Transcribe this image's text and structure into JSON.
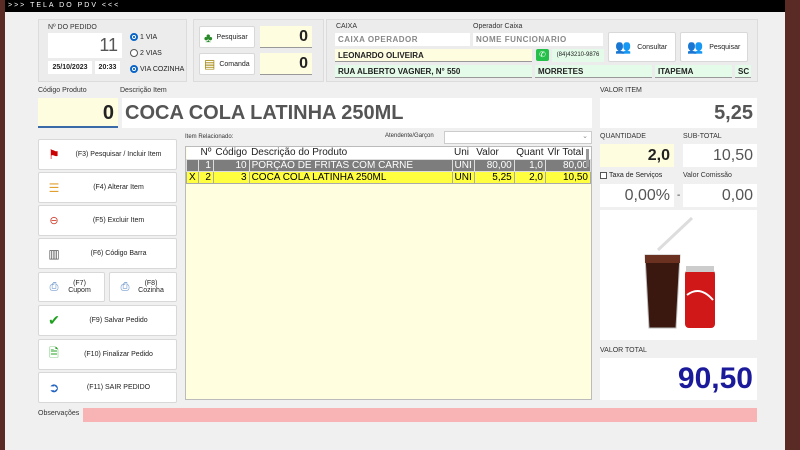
{
  "window": {
    "title": ">>> TELA DO PDV <<<"
  },
  "pedido": {
    "label": "Nº DO PEDIDO",
    "number": "11",
    "date": "25/10/2023",
    "time": "20:33",
    "options": [
      {
        "label": "1 VIA",
        "checked": true
      },
      {
        "label": "2 VIAS",
        "checked": false
      },
      {
        "label": "VIA COZINHA",
        "checked": true
      }
    ]
  },
  "search": {
    "pesquisar_label": "Pesquisar",
    "pesquisar_value": "0",
    "comanda_label": "Comanda",
    "comanda_value": "0"
  },
  "caixa": {
    "caixa_label": "CAIXA",
    "caixa_value": "CAIXA OPERADOR",
    "operador_label": "Operador Caixa",
    "operador_value": "NOME FUNCIONARIO",
    "customer": "LEONARDO OLIVEIRA",
    "phone": "(84)43210-9876",
    "address": "RUA ALBERTO VAGNER, N° 550",
    "district": "MORRETES",
    "city": "ITAPEMA",
    "state": "SC",
    "consultar_label": "Consultar",
    "pesquisar_label": "Pesquisar"
  },
  "item": {
    "codigo_label": "Código Produto",
    "codigo_value": "0",
    "descricao_label": "Descrição Item",
    "descricao_value": "COCA COLA LATINHA 250ML"
  },
  "actions": [
    {
      "label": "(F3) Pesquisar / Incluir Item",
      "icon": "tables-icon"
    },
    {
      "label": "(F4) Alterar Item",
      "icon": "edit-list-icon"
    },
    {
      "label": "(F5) Excluir Item",
      "icon": "delete-item-icon"
    },
    {
      "label": "(F6) Código Barra",
      "icon": "barcode-icon"
    },
    {
      "label": "(F7) Cupom",
      "icon": "printer-icon"
    },
    {
      "label": "(F8) Cozinha",
      "icon": "printer-icon"
    },
    {
      "label": "(F9) Salvar Pedido",
      "icon": "checkmark-icon"
    },
    {
      "label": "(F10) Finalizar Pedido",
      "icon": "finalize-document-icon"
    },
    {
      "label": "(F11) SAIR PEDIDO",
      "icon": "exit-icon"
    }
  ],
  "grid": {
    "item_relacionado_label": "Item Relacionado:",
    "atendente_label": "Atendente/Garçon",
    "atendente_value": "",
    "columns": [
      "",
      "Nº",
      "Código",
      "Descrição do Produto",
      "Uni",
      "Valor",
      "Quant",
      "Vlr Total"
    ],
    "rows": [
      [
        "",
        "1",
        "10",
        "PORÇÃO DE FRITAS COM CARNE",
        "UNI",
        "80,00",
        "1,0",
        "80,00"
      ],
      [
        "X",
        "2",
        "3",
        "COCA COLA LATINHA 250ML",
        "UNI",
        "5,25",
        "2,0",
        "10,50"
      ]
    ]
  },
  "totals": {
    "valor_item_label": "VALOR ITEM",
    "valor_item": "5,25",
    "quantidade_label": "QUANTIDADE",
    "quantidade": "2,0",
    "subtotal_label": "SUB-TOTAL",
    "subtotal": "10,50",
    "taxa_label": "Taxa de Serviços",
    "taxa_checked": false,
    "taxa_value": "0,00%",
    "comissao_label": "Valor Comissão",
    "comissao_value": "0,00",
    "separator": "-",
    "valor_total_label": "VALOR TOTAL",
    "valor_total": "90,50"
  },
  "obs": {
    "label": "Observações",
    "value": ""
  },
  "colors": {
    "accent_blue": "#1a1a9a",
    "highlight_yellow": "#ffff40",
    "input_yellow": "#fffde0",
    "obs_pink": "#f8b4b4",
    "address_green": "#e3fbe8"
  }
}
